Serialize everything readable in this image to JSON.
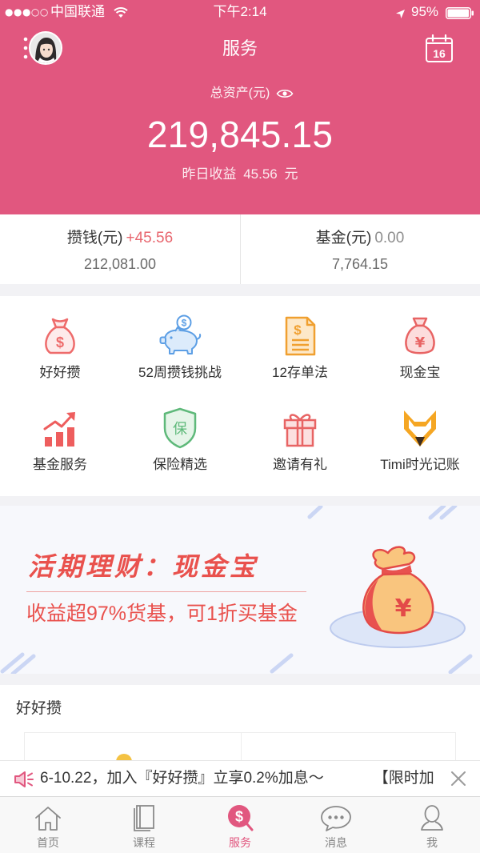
{
  "status_bar": {
    "signal": "●●●○○",
    "carrier": "中国联通",
    "time": "下午2:14",
    "battery": "95%"
  },
  "header": {
    "title": "服务",
    "calendar_day": "16",
    "menu_icon": "more-dots-icon",
    "calendar_icon": "calendar-icon"
  },
  "assets": {
    "label": "总资产(元)",
    "eye_icon": "eye-icon",
    "total": "219,845.15",
    "yesterday_label": "昨日收益",
    "yesterday_value": "45.56",
    "yesterday_unit": "元"
  },
  "accounts": [
    {
      "label": "攒钱(元)",
      "change": "+45.56",
      "balance": "212,081.00"
    },
    {
      "label": "基金(元)",
      "change": "0.00",
      "balance": "7,764.15"
    }
  ],
  "services": [
    {
      "label": "好好攒",
      "icon": "money-bag-dollar-icon"
    },
    {
      "label": "52周攒钱挑战",
      "icon": "piggy-bank-icon"
    },
    {
      "label": "12存单法",
      "icon": "deposit-document-icon"
    },
    {
      "label": "现金宝",
      "icon": "money-bag-yuan-icon"
    },
    {
      "label": "基金服务",
      "icon": "rising-chart-icon"
    },
    {
      "label": "保险精选",
      "icon": "insurance-shield-icon",
      "icon_text": "保"
    },
    {
      "label": "邀请有礼",
      "icon": "gift-icon"
    },
    {
      "label": "Timi时光记账",
      "icon": "fox-icon"
    }
  ],
  "banner": {
    "title": "活期理财：现金宝",
    "subtitle": "收益超97%货基，可1折买基金",
    "illustration": "money-bag-illustration"
  },
  "section": {
    "title": "好好攒"
  },
  "notice": {
    "icon": "speaker-icon",
    "text": "6-10.22，加入『好好攒』立享0.2%加息～",
    "text_next": "【限时加",
    "close_icon": "close-icon"
  },
  "tabs": [
    {
      "label": "首页",
      "icon": "home-icon",
      "active": false
    },
    {
      "label": "课程",
      "icon": "book-icon",
      "active": false
    },
    {
      "label": "服务",
      "icon": "service-dollar-icon",
      "active": true
    },
    {
      "label": "消息",
      "icon": "message-bubble-icon",
      "active": false
    },
    {
      "label": "我",
      "icon": "person-icon",
      "active": false
    }
  ],
  "colors": {
    "brand": "#E1577F",
    "gain": "#E8676F",
    "banner_text": "#E9514D",
    "tab_inactive": "#858585"
  }
}
